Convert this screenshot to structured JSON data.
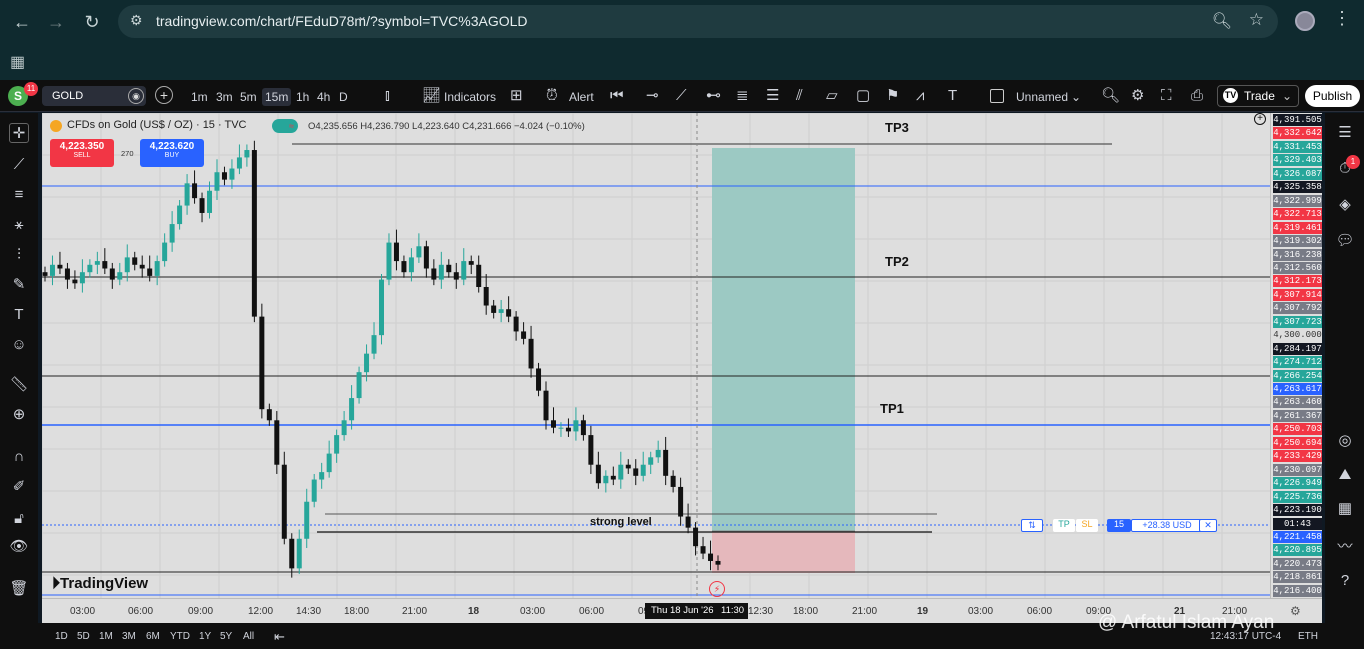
{
  "browser": {
    "url": "tradingview.com/chart/FEduD78m/?symbol=TVC%3AGOLD"
  },
  "toolbar": {
    "notif_count": "11",
    "symbol": "GOLD",
    "intervals": [
      "1m",
      "3m",
      "5m",
      "15m",
      "1h",
      "4h",
      "D"
    ],
    "active_interval": "15m",
    "indicators_label": "Indicators",
    "alert_label": "Alert",
    "layout_name": "Unnamed",
    "trade_label": "Trade",
    "publish_label": "Publish"
  },
  "legend": {
    "title": "CFDs on Gold (US$ / OZ) · 15 · TVC",
    "ohlc": "O4,235.656 H4,236.790 L4,223.640 C4,231.666 −4.024 (−0.10%)",
    "sell_price": "4,223.350",
    "sell_label": "SELL",
    "buy_price": "4,223.620",
    "buy_label": "BUY",
    "spread": "270"
  },
  "annotations": {
    "tp3": "TP3",
    "tp2": "TP2",
    "tp1": "TP1",
    "strong_level": "strong level"
  },
  "position": {
    "tp": "TP",
    "sl": "SL",
    "qty": "15",
    "pnl": "+28.38 USD"
  },
  "price_labels": [
    {
      "v": "4,391.505",
      "c": "#131722"
    },
    {
      "v": "4,332.642",
      "c": "#f23645"
    },
    {
      "v": "4,331.453",
      "c": "#26a69a"
    },
    {
      "v": "4,329.403",
      "c": "#26a69a"
    },
    {
      "v": "4,326.087",
      "c": "#26a69a"
    },
    {
      "v": "4,325.358",
      "c": "#131722"
    },
    {
      "v": "4,322.999",
      "c": "#787b86"
    },
    {
      "v": "4,322.713",
      "c": "#f23645"
    },
    {
      "v": "4,319.461",
      "c": "#f23645"
    },
    {
      "v": "4,319.302",
      "c": "#787b86"
    },
    {
      "v": "4,316.238",
      "c": "#787b86"
    },
    {
      "v": "4,312.560",
      "c": "#787b86"
    },
    {
      "v": "4,312.173",
      "c": "#f23645"
    },
    {
      "v": "4,307.914",
      "c": "#f23645"
    },
    {
      "v": "4,307.792",
      "c": "#787b86"
    },
    {
      "v": "4,307.723",
      "c": "#26a69a"
    },
    {
      "v": "4,300.000",
      "c": "none"
    },
    {
      "v": "4,284.197",
      "c": "#131722"
    },
    {
      "v": "4,274.712",
      "c": "#26a69a"
    },
    {
      "v": "4,266.254",
      "c": "#26a69a"
    },
    {
      "v": "4,263.617",
      "c": "#2962ff"
    },
    {
      "v": "4,263.460",
      "c": "#787b86"
    },
    {
      "v": "4,261.367",
      "c": "#787b86"
    },
    {
      "v": "4,250.703",
      "c": "#f23645"
    },
    {
      "v": "4,250.694",
      "c": "#f23645"
    },
    {
      "v": "4,233.429",
      "c": "#f23645"
    },
    {
      "v": "4,230.097",
      "c": "#787b86"
    },
    {
      "v": "4,226.949",
      "c": "#26a69a"
    },
    {
      "v": "4,225.736",
      "c": "#26a69a"
    },
    {
      "v": "4,223.190",
      "c": "#131722"
    },
    {
      "v": "01:43",
      "c": "#131722"
    },
    {
      "v": "4,221.458",
      "c": "#2962ff"
    },
    {
      "v": "4,220.895",
      "c": "#26a69a"
    },
    {
      "v": "4,220.473",
      "c": "#787b86"
    },
    {
      "v": "4,218.861",
      "c": "#787b86"
    },
    {
      "v": "4,216.400",
      "c": "#787b86"
    }
  ],
  "time_labels": [
    "03:00",
    "06:00",
    "09:00",
    "12:00",
    "14:30",
    "18:00",
    "21:00",
    "18",
    "03:00",
    "06:00",
    "09",
    "12:30",
    "18:00",
    "21:00",
    "19",
    "03:00",
    "06:00",
    "09:00",
    "21",
    "21:00"
  ],
  "crosshair_date": "Thu 18 Jun '26",
  "crosshair_time": "11:30",
  "bottom": {
    "ranges": [
      "1D",
      "5D",
      "1M",
      "3M",
      "6M",
      "YTD",
      "1Y",
      "5Y",
      "All"
    ],
    "clock": "12:43:17 UTC-4",
    "currency": "ETH"
  },
  "branding": {
    "tv_logo": "TradingView",
    "watermark": "@ Arfatul Islam Ayan"
  },
  "chart_data": {
    "type": "candlestick",
    "symbol": "GOLD",
    "timeframe": "15m",
    "levels": [
      {
        "name": "TP3",
        "price": 4331.45
      },
      {
        "name": "TP2",
        "price": 4307.72
      },
      {
        "name": "TP1",
        "price": 4263.62
      },
      {
        "name": "strong level",
        "price": 4223.19
      }
    ],
    "candles_close": [
      4301,
      4304,
      4303,
      4300,
      4299,
      4302,
      4304,
      4305,
      4303,
      4300,
      4302,
      4306,
      4304,
      4303,
      4301,
      4305,
      4310,
      4315,
      4320,
      4326,
      4322,
      4318,
      4324,
      4329,
      4327,
      4330,
      4333,
      4335,
      4290,
      4265,
      4262,
      4250,
      4230,
      4222,
      4230,
      4240,
      4246,
      4248,
      4253,
      4258,
      4262,
      4268,
      4275,
      4280,
      4285,
      4300,
      4310,
      4305,
      4302,
      4306,
      4309,
      4303,
      4300,
      4304,
      4302,
      4300,
      4305,
      4304,
      4298,
      4293,
      4291,
      4292,
      4290,
      4286,
      4284,
      4276,
      4270,
      4262,
      4260,
      4260,
      4259,
      4262,
      4258,
      4250,
      4245,
      4247,
      4246,
      4250,
      4249,
      4247,
      4250,
      4252,
      4254,
      4247,
      4244,
      4236,
      4233,
      4228,
      4226,
      4224,
      4223
    ]
  }
}
